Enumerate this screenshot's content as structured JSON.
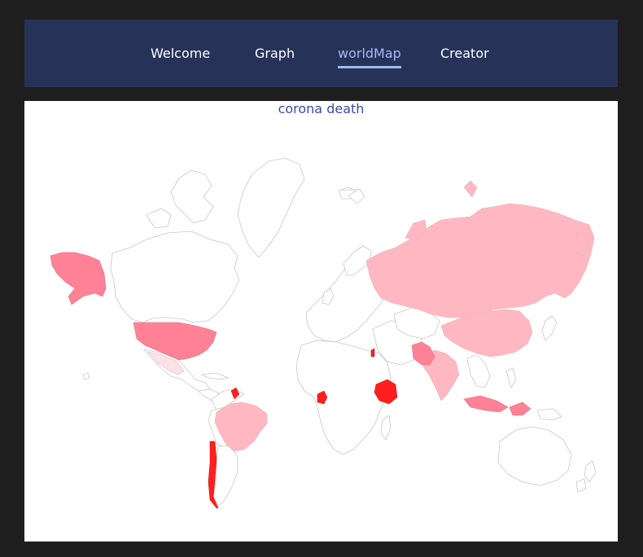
{
  "nav": {
    "tabs": [
      {
        "label": "Welcome",
        "active": false
      },
      {
        "label": "Graph",
        "active": false
      },
      {
        "label": "worldMap",
        "active": true
      },
      {
        "label": "Creator",
        "active": false
      }
    ]
  },
  "map": {
    "title": "corona death",
    "colors": {
      "border": "#c8c8c8",
      "no_data": "#ffffff",
      "low": "#ffe0e4",
      "medium_low": "#ffb8c2",
      "medium": "#ff8196",
      "high": "#ff1f1f",
      "highlight_accent": "#a3b8f5"
    }
  }
}
